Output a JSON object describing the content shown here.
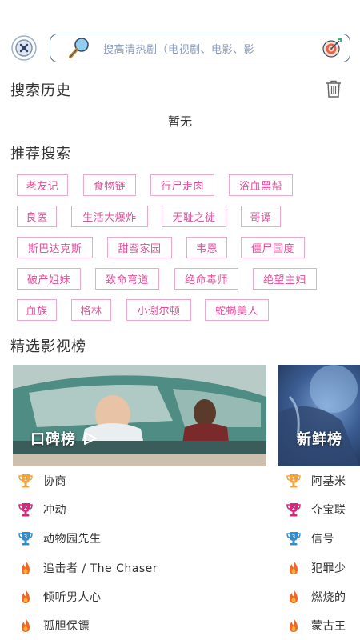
{
  "search": {
    "placeholder": "搜高清热剧（电视剧、电影、影"
  },
  "history": {
    "title": "搜索历史",
    "empty": "暂无"
  },
  "recommend": {
    "title": "推荐搜索",
    "rows": [
      [
        "老友记",
        "食物链",
        "行尸走肉",
        "浴血黑帮"
      ],
      [
        "良医",
        "生活大爆炸",
        "无耻之徒",
        "哥谭"
      ],
      [
        "斯巴达克斯",
        "甜蜜家园",
        "韦恩",
        "僵尸国度"
      ],
      [
        "破产姐妹",
        "致命弯道",
        "绝命毒师",
        "绝望主妇"
      ],
      [
        "血族",
        "格林",
        "小谢尔顿",
        "蛇蝎美人"
      ]
    ]
  },
  "rankings": {
    "title": "精选影视榜",
    "cards": [
      {
        "label": "口碑榜"
      },
      {
        "label": "新鲜榜"
      }
    ],
    "list_left": [
      "协商",
      "冲动",
      "动物园先生",
      "追击者 / The Chaser",
      "倾听男人心",
      "孤胆保镖"
    ],
    "list_right": [
      "阿基米",
      "夺宝联",
      "信号",
      "犯罪少",
      "燃烧的",
      "蒙古王"
    ],
    "badge_colors": [
      "#f2a33a",
      "#d6277c",
      "#2b8fd6",
      "#f26522",
      "#f26522",
      "#f26522"
    ]
  }
}
